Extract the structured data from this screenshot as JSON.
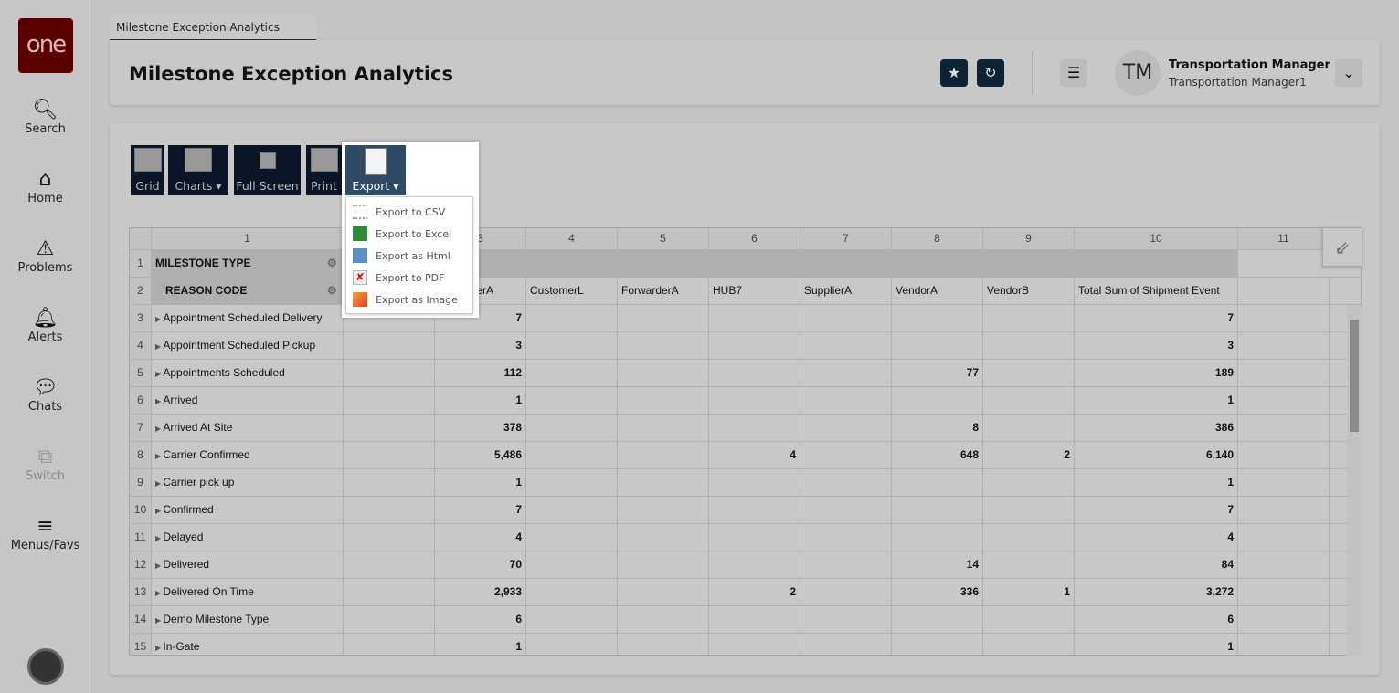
{
  "app": {
    "logo": "one"
  },
  "sidebar": {
    "items": [
      {
        "label": "Search",
        "icon": "search-icon"
      },
      {
        "label": "Home",
        "icon": "home-icon"
      },
      {
        "label": "Problems",
        "icon": "warning-icon"
      },
      {
        "label": "Alerts",
        "icon": "bell-icon"
      },
      {
        "label": "Chats",
        "icon": "chat-icon"
      },
      {
        "label": "Switch",
        "icon": "switch-icon"
      },
      {
        "label": "Menus/Favs",
        "icon": "menu-icon"
      }
    ]
  },
  "tab": {
    "label": "Milestone Exception Analytics"
  },
  "header": {
    "title": "Milestone Exception Analytics",
    "user_initials": "TM",
    "user_name": "Transportation Manager",
    "user_role": "Transportation Manager1"
  },
  "toolbar": {
    "grid": "Grid",
    "charts": "Charts",
    "fullscreen": "Full Screen",
    "print": "Print",
    "export": "Export"
  },
  "export_menu": [
    "Export to CSV",
    "Export to Excel",
    "Export as Html",
    "Export to PDF",
    "Export as Image"
  ],
  "grid": {
    "col_numbers": [
      "1",
      "2",
      "3",
      "4",
      "5",
      "6",
      "7",
      "8",
      "9",
      "10",
      "11"
    ],
    "row1_label": "MILESTONE TYPE",
    "row2_label": "REASON CODE",
    "col_headers": [
      "",
      "CustomerA",
      "CustomerL",
      "ForwarderA",
      "HUB7",
      "SupplierA",
      "VendorA",
      "VendorB",
      "Total Sum of Shipment Event",
      ""
    ],
    "rows": [
      {
        "n": "3",
        "label": "Appointment Scheduled Delivery",
        "v": [
          "",
          "7",
          "",
          "",
          "",
          "",
          "",
          "",
          "7",
          ""
        ]
      },
      {
        "n": "4",
        "label": "Appointment Scheduled Pickup",
        "v": [
          "",
          "3",
          "",
          "",
          "",
          "",
          "",
          "",
          "3",
          ""
        ]
      },
      {
        "n": "5",
        "label": "Appointments Scheduled",
        "v": [
          "",
          "112",
          "",
          "",
          "",
          "",
          "77",
          "",
          "189",
          ""
        ]
      },
      {
        "n": "6",
        "label": "Arrived",
        "v": [
          "",
          "1",
          "",
          "",
          "",
          "",
          "",
          "",
          "1",
          ""
        ]
      },
      {
        "n": "7",
        "label": "Arrived At Site",
        "v": [
          "",
          "378",
          "",
          "",
          "",
          "",
          "8",
          "",
          "386",
          ""
        ]
      },
      {
        "n": "8",
        "label": "Carrier Confirmed",
        "v": [
          "",
          "5,486",
          "",
          "",
          "4",
          "",
          "648",
          "2",
          "6,140",
          ""
        ]
      },
      {
        "n": "9",
        "label": "Carrier pick up",
        "v": [
          "",
          "1",
          "",
          "",
          "",
          "",
          "",
          "",
          "1",
          ""
        ]
      },
      {
        "n": "10",
        "label": "Confirmed",
        "v": [
          "",
          "7",
          "",
          "",
          "",
          "",
          "",
          "",
          "7",
          ""
        ]
      },
      {
        "n": "11",
        "label": "Delayed",
        "v": [
          "",
          "4",
          "",
          "",
          "",
          "",
          "",
          "",
          "4",
          ""
        ]
      },
      {
        "n": "12",
        "label": "Delivered",
        "v": [
          "",
          "70",
          "",
          "",
          "",
          "",
          "14",
          "",
          "84",
          ""
        ]
      },
      {
        "n": "13",
        "label": "Delivered On Time",
        "v": [
          "",
          "2,933",
          "",
          "",
          "2",
          "",
          "336",
          "1",
          "3,272",
          ""
        ]
      },
      {
        "n": "14",
        "label": "Demo Milestone Type",
        "v": [
          "",
          "6",
          "",
          "",
          "",
          "",
          "",
          "",
          "6",
          ""
        ]
      },
      {
        "n": "15",
        "label": "In-Gate",
        "v": [
          "",
          "1",
          "",
          "",
          "",
          "",
          "",
          "",
          "1",
          ""
        ]
      }
    ]
  }
}
